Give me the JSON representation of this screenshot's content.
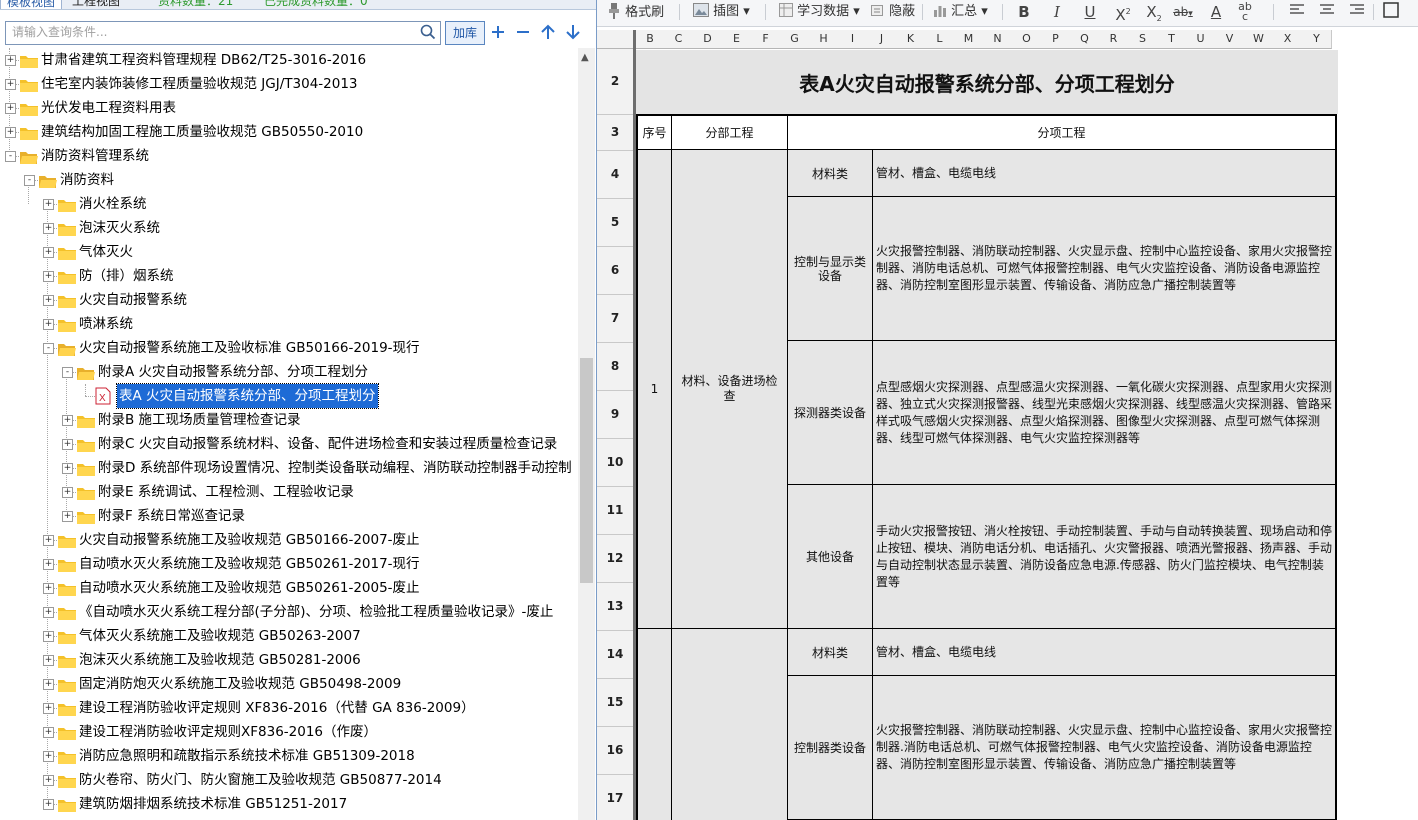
{
  "left_panel": {
    "tabs": [
      "模板视图",
      "工程视图"
    ],
    "counts": [
      "资料数量：21",
      "已完成资料数量：0"
    ],
    "search": {
      "placeholder": "请输入查询条件...",
      "load_label": "加库"
    },
    "tree": [
      {
        "label": "甘肃省建筑工程资料管理规程 DB62/T25-3016-2016",
        "level": 0,
        "exp": "+"
      },
      {
        "label": "住宅室内装饰装修工程质量验收规范 JGJ/T304-2013",
        "level": 0,
        "exp": "+"
      },
      {
        "label": "光伏发电工程资料用表",
        "level": 0,
        "exp": "+"
      },
      {
        "label": "建筑结构加固工程施工质量验收规范 GB50550-2010",
        "level": 0,
        "exp": "+"
      },
      {
        "label": "消防资料管理系统",
        "level": 0,
        "exp": "-",
        "open": true
      },
      {
        "label": "消防资料",
        "level": 1,
        "exp": "-",
        "open": true
      },
      {
        "label": "消火栓系统",
        "level": 2,
        "exp": "+"
      },
      {
        "label": "泡沫灭火系统",
        "level": 2,
        "exp": "+"
      },
      {
        "label": "气体灭火",
        "level": 2,
        "exp": "+"
      },
      {
        "label": "防（排）烟系统",
        "level": 2,
        "exp": "+"
      },
      {
        "label": "火灾自动报警系统",
        "level": 2,
        "exp": "+"
      },
      {
        "label": "喷淋系统",
        "level": 2,
        "exp": "+"
      },
      {
        "label": "火灾自动报警系统施工及验收标准 GB50166-2019-现行",
        "level": 2,
        "exp": "-",
        "open": true
      },
      {
        "label": "附录A 火灾自动报警系统分部、分项工程划分",
        "level": 3,
        "exp": "-",
        "open": true
      },
      {
        "label": "表A 火灾自动报警系统分部、分项工程划分",
        "level": 4,
        "exp": "",
        "file": true,
        "selected": true
      },
      {
        "label": "附录B 施工现场质量管理检查记录",
        "level": 3,
        "exp": "+"
      },
      {
        "label": "附录C 火灾自动报警系统材料、设备、配件进场检查和安装过程质量检查记录",
        "level": 3,
        "exp": "+"
      },
      {
        "label": "附录D 系统部件现场设置情况、控制类设备联动编程、消防联动控制器手动控制",
        "level": 3,
        "exp": "+"
      },
      {
        "label": "附录E 系统调试、工程检测、工程验收记录",
        "level": 3,
        "exp": "+"
      },
      {
        "label": "附录F 系统日常巡查记录",
        "level": 3,
        "exp": "+"
      },
      {
        "label": "火灾自动报警系统施工及验收规范 GB50166-2007-废止",
        "level": 2,
        "exp": "+"
      },
      {
        "label": "自动喷水灭火系统施工及验收规范 GB50261-2017-现行",
        "level": 2,
        "exp": "+"
      },
      {
        "label": "自动喷水灭火系统施工及验收规范 GB50261-2005-废止",
        "level": 2,
        "exp": "+"
      },
      {
        "label": "《自动喷水灭火系统工程分部(子分部)、分项、检验批工程质量验收记录》-废止",
        "level": 2,
        "exp": "+"
      },
      {
        "label": "气体灭火系统施工及验收规范 GB50263-2007",
        "level": 2,
        "exp": "+"
      },
      {
        "label": "泡沫灭火系统施工及验收规范 GB50281-2006",
        "level": 2,
        "exp": "+"
      },
      {
        "label": "固定消防炮灭火系统施工及验收规范 GB50498-2009",
        "level": 2,
        "exp": "+"
      },
      {
        "label": "建设工程消防验收评定规则 XF836-2016（代替 GA 836-2009）",
        "level": 2,
        "exp": "+"
      },
      {
        "label": "建设工程消防验收评定规则XF836-2016（作废）",
        "level": 2,
        "exp": "+"
      },
      {
        "label": "消防应急照明和疏散指示系统技术标准 GB51309-2018",
        "level": 2,
        "exp": "+"
      },
      {
        "label": "防火卷帘、防火门、防火窗施工及验收规范 GB50877-2014",
        "level": 2,
        "exp": "+"
      },
      {
        "label": "建筑防烟排烟系统技术标准 GB51251-2017",
        "level": 2,
        "exp": "+"
      }
    ]
  },
  "toolbar": {
    "format_painter": "格式刷",
    "insert_image": "插图",
    "study_data": "学习数据",
    "hide": "隐蔽",
    "summary": "汇总"
  },
  "sheet": {
    "columns": [
      "B",
      "C",
      "D",
      "E",
      "F",
      "G",
      "H",
      "I",
      "J",
      "K",
      "L",
      "M",
      "N",
      "O",
      "P",
      "Q",
      "R",
      "S",
      "T",
      "U",
      "V",
      "W",
      "X",
      "Y"
    ],
    "rows": [
      "2",
      "3",
      "4",
      "5",
      "6",
      "7",
      "8",
      "9",
      "10",
      "11",
      "12",
      "13",
      "14",
      "15",
      "16",
      "17"
    ],
    "title": "表A火灾自动报警系统分部、分项工程划分",
    "headers": {
      "seq": "序号",
      "division": "分部工程",
      "subitem": "分项工程"
    },
    "group1": {
      "seq": "1",
      "division": "材料、设备进场检查",
      "items": [
        {
          "category": "材料类",
          "content": "管材、槽盒、电缆电线"
        },
        {
          "category": "控制与显示类设备",
          "content": "火灾报警控制器、消防联动控制器、火灾显示盘、控制中心监控设备、家用火灾报警控制器、消防电话总机、可燃气体报警控制器、电气火灾监控设备、消防设备电源监控器、消防控制室图形显示装置、传输设备、消防应急广播控制装置等"
        },
        {
          "category": "探测器类设备",
          "content": "点型感烟火灾探测器、点型感温火灾探测器、一氧化碳火灾探测器、点型家用火灾探测器、独立式火灾探测报警器、线型光束感烟火灾探测器、线型感温火灾探测器、管路采样式吸气感烟火灾探测器、点型火焰探测器、图像型火灾探测器、点型可燃气体探测器、线型可燃气体探测器、电气火灾监控探测器等"
        },
        {
          "category": "其他设备",
          "content": "手动火灾报警按钮、消火栓按钮、手动控制装置、手动与自动转换装置、现场启动和停止按钮、模块、消防电话分机、电话插孔、火灾警报器、喷洒光警报器、扬声器、手动与自动控制状态显示装置、消防设备应急电源.传感器、防火门监控模块、电气控制装置等"
        }
      ]
    },
    "group2": {
      "items": [
        {
          "category": "材料类",
          "content": "管材、槽盒、电缆电线"
        },
        {
          "category": "控制器类设备",
          "content": "火灾报警控制器、消防联动控制器、火灾显示盘、控制中心监控设备、家用火灾报警控制器.消防电话总机、可燃气体报警控制器、电气火灾监控设备、消防设备电源监控器、消防控制室图形显示装置、传输设备、消防应急广播控制装置等"
        }
      ]
    }
  }
}
